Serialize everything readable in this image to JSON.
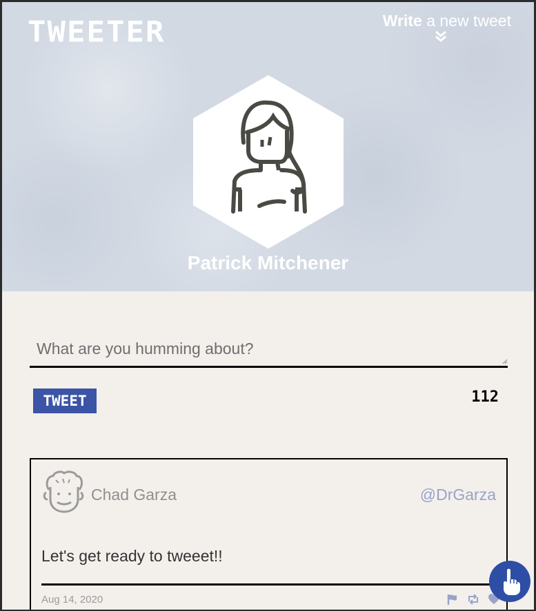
{
  "header": {
    "brand": "TWEETER",
    "compose_bold": "Write",
    "compose_rest": " a new tweet",
    "user_name": "Patrick Mitchener"
  },
  "composer": {
    "placeholder": "What are you humming about?",
    "value": "",
    "submit_label": "TWEET",
    "char_counter": "112"
  },
  "tweets": [
    {
      "author_name": "Chad Garza",
      "handle": "@DrGarza",
      "text": "Let's get ready to tweeet!!",
      "date": "Aug 14, 2020",
      "actions": [
        "flag-icon",
        "retweet-icon",
        "heart-icon"
      ]
    }
  ],
  "colors": {
    "accent": "#3b54a6",
    "hero_bg": "#d2d9e3",
    "page_bg": "#f3f0ec",
    "handle": "#98a3c8"
  },
  "floating_button_icon": "pointing-hand-icon"
}
